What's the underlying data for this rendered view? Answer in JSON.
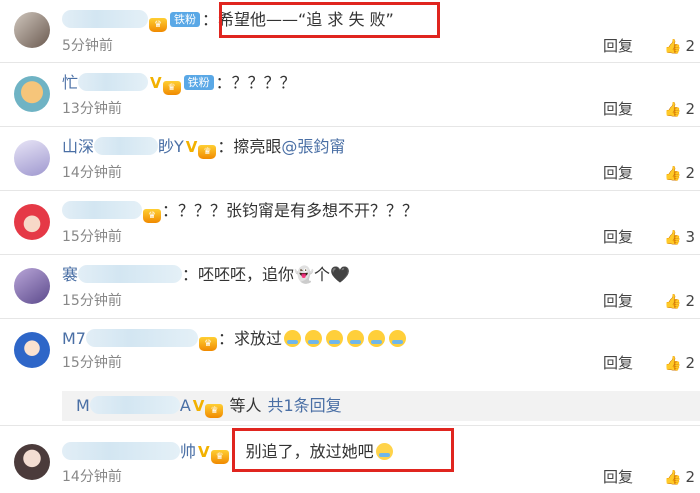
{
  "comments": [
    {
      "name": "",
      "badge": "铁粉",
      "text": "：希望他——“追 求 失 败”",
      "time": "5分钟前",
      "reply": "回复",
      "likes": "2"
    },
    {
      "name": "忙",
      "badge": "铁粉",
      "text": "：？？？？",
      "time": "13分钟前",
      "reply": "回复",
      "likes": "2"
    },
    {
      "name": "山深",
      "name_tail": "眇Y",
      "text": "：擦亮眼",
      "mention": "@張鈞甯",
      "time": "14分钟前",
      "reply": "回复",
      "likes": "2"
    },
    {
      "name": "",
      "text": "：？？？张钧甯是有多想不开？？？",
      "time": "15分钟前",
      "reply": "回复",
      "likes": "3"
    },
    {
      "name": "褰",
      "text": "：呸呸呸，追你",
      "text_tail": "个",
      "time": "15分钟前",
      "reply": "回复",
      "likes": "2"
    },
    {
      "name": "M7",
      "text": "：求放过",
      "time": "15分钟前",
      "reply": "回复",
      "likes": "2"
    },
    {
      "name": "",
      "name_tail": "帅",
      "text": "：别追了，放过她吧",
      "time": "14分钟前",
      "reply": "回复",
      "likes": "2"
    }
  ],
  "reply_bar": {
    "name": "M",
    "name_tail": "A",
    "suffix": " 等人",
    "more": "共1条回复"
  },
  "icons": {
    "thumb": "thumbs-up-icon",
    "crown": "crown-badge-icon",
    "verified": "verified-v-icon"
  },
  "colors": {
    "username": "#4a6fa5",
    "highlight": "#e0251f",
    "fan_badge": "#5aa8e6"
  }
}
